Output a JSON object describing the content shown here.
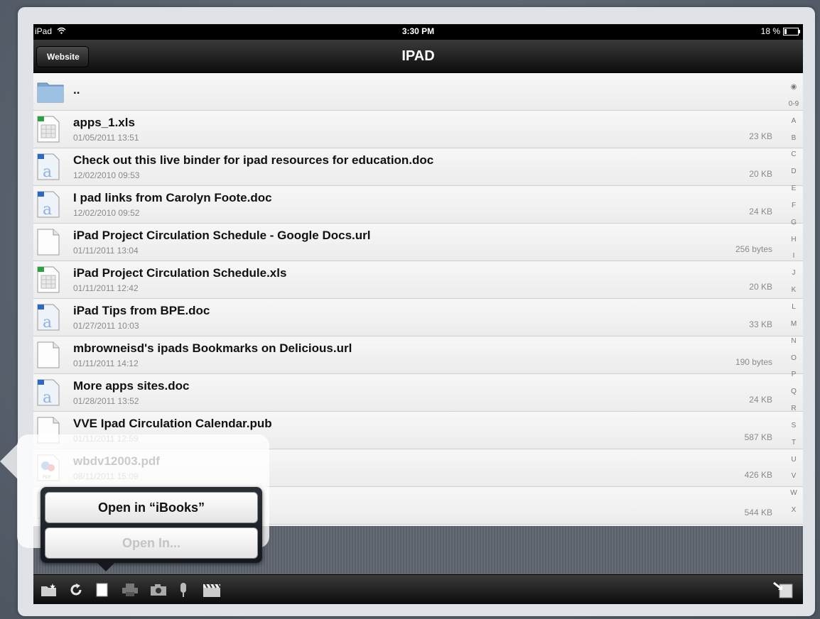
{
  "status_bar": {
    "carrier": "iPad",
    "time": "3:30 PM",
    "battery": "18 %"
  },
  "nav": {
    "back_label": "Website",
    "title": "IPAD"
  },
  "parent_folder": {
    "name": ".."
  },
  "files": [
    {
      "icon": "excel-file-icon",
      "name": "apps_1.xls",
      "date": "01/05/2011 13:51",
      "size": "23 KB"
    },
    {
      "icon": "word-file-icon",
      "name": "Check out this live binder for ipad resources for education.doc",
      "date": "12/02/2010 09:53",
      "size": "20 KB"
    },
    {
      "icon": "word-file-icon",
      "name": "I pad links from Carolyn Foote.doc",
      "date": "12/02/2010 09:52",
      "size": "24 KB"
    },
    {
      "icon": "blank-file-icon",
      "name": "iPad Project Circulation Schedule - Google Docs.url",
      "date": "01/11/2011 13:04",
      "size": "256 bytes"
    },
    {
      "icon": "excel-file-icon",
      "name": "iPad Project Circulation Schedule.xls",
      "date": "01/11/2011 12:42",
      "size": "20 KB"
    },
    {
      "icon": "word-file-icon",
      "name": "iPad Tips from BPE.doc",
      "date": "01/27/2011 10:03",
      "size": "33 KB"
    },
    {
      "icon": "blank-file-icon",
      "name": "mbrowneisd's ipads Bookmarks on Delicious.url",
      "date": "01/11/2011 14:12",
      "size": "190 bytes"
    },
    {
      "icon": "word-file-icon",
      "name": "More apps sites.doc",
      "date": "01/28/2011 13:52",
      "size": "24 KB"
    },
    {
      "icon": "blank-file-icon",
      "name": "VVE Ipad Circulation Calendar.pub",
      "date": "01/11/2011 12:59",
      "size": "587 KB"
    },
    {
      "icon": "pdf-file-icon",
      "name": "wbdv12003.pdf",
      "date": "08/11/2011 15:09",
      "size": "426 KB"
    },
    {
      "icon": "blank-file-icon",
      "name": "",
      "date": "",
      "size": "544 KB"
    }
  ],
  "index": [
    "◉",
    "0-9",
    "A",
    "B",
    "C",
    "D",
    "E",
    "F",
    "G",
    "H",
    "I",
    "J",
    "K",
    "L",
    "M",
    "N",
    "O",
    "P",
    "Q",
    "R",
    "S",
    "T",
    "U",
    "V",
    "W",
    "X"
  ],
  "action_sheet": {
    "open_in_app": "Open in “iBooks”",
    "open_in": "Open In..."
  },
  "toolbar": [
    "new-folder-icon",
    "refresh-icon",
    "document-icon",
    "printer-icon",
    "camera-icon",
    "microphone-icon",
    "clapperboard-icon",
    "export-icon"
  ]
}
